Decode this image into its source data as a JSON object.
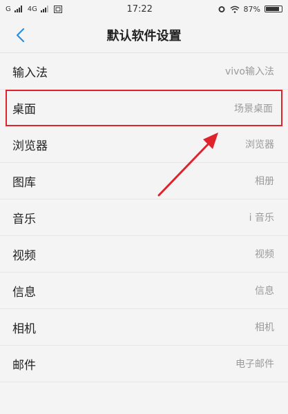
{
  "status_bar": {
    "carrier_left": "G",
    "network": "4G",
    "sim_icon": "sim-icon",
    "time": "17:22",
    "battery": "87%"
  },
  "header": {
    "back_icon": "back-chevron-icon",
    "title": "默认软件设置"
  },
  "items": [
    {
      "label": "输入法",
      "value": "vivo输入法"
    },
    {
      "label": "桌面",
      "value": "场景桌面"
    },
    {
      "label": "浏览器",
      "value": "浏览器"
    },
    {
      "label": "图库",
      "value": "相册"
    },
    {
      "label": "音乐",
      "value": "i 音乐"
    },
    {
      "label": "视频",
      "value": "视频"
    },
    {
      "label": "信息",
      "value": "信息"
    },
    {
      "label": "相机",
      "value": "相机"
    },
    {
      "label": "邮件",
      "value": "电子邮件"
    }
  ],
  "colors": {
    "accent": "#2a8ee0",
    "highlight": "#e0222a",
    "value_text": "#9a9a9a"
  },
  "battery_level": 0.87
}
